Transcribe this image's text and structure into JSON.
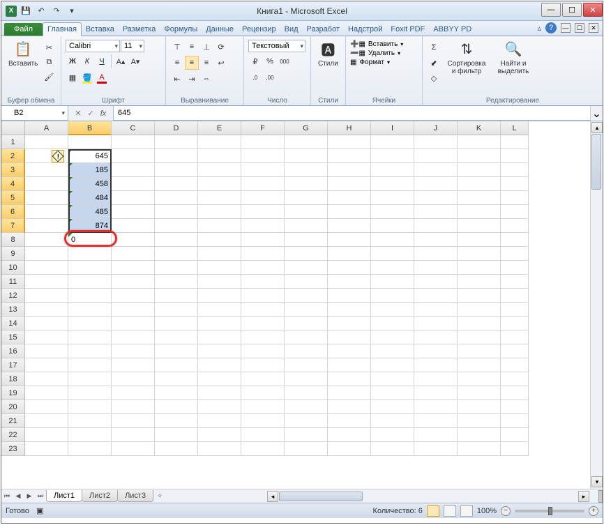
{
  "window": {
    "title": "Книга1 - Microsoft Excel"
  },
  "tabs": {
    "file": "Файл",
    "list": [
      "Главная",
      "Вставка",
      "Разметка",
      "Формулы",
      "Данные",
      "Рецензир",
      "Вид",
      "Разработ",
      "Надстрой",
      "Foxit PDF",
      "ABBYY PD"
    ],
    "active_index": 0
  },
  "ribbon": {
    "clipboard": {
      "label": "Буфер обмена",
      "paste": "Вставить"
    },
    "font": {
      "label": "Шрифт",
      "name": "Calibri",
      "size": "11",
      "bold": "Ж",
      "italic": "К",
      "underline": "Ч"
    },
    "alignment": {
      "label": "Выравнивание"
    },
    "number": {
      "label": "Число",
      "format": "Текстовый",
      "percent": "%",
      "comma": "000",
      "inc": ",0",
      "dec": ",00"
    },
    "styles": {
      "label": "Стили",
      "btn": "Стили"
    },
    "cells": {
      "label": "Ячейки",
      "insert": "Вставить",
      "delete": "Удалить",
      "format": "Формат"
    },
    "editing": {
      "label": "Редактирование",
      "sort": "Сортировка и фильтр",
      "find": "Найти и выделить"
    }
  },
  "formula_bar": {
    "name_box": "B2",
    "fx": "fx",
    "value": "645"
  },
  "grid": {
    "columns": [
      "A",
      "B",
      "C",
      "D",
      "E",
      "F",
      "G",
      "H",
      "I",
      "J",
      "K",
      "L"
    ],
    "row_count": 23,
    "selected_col": "B",
    "selected_rows_start": 2,
    "selected_rows_end": 7,
    "active_cell": "B2",
    "cells": {
      "B2": "645",
      "B3": "185",
      "B4": "458",
      "B5": "484",
      "B6": "485",
      "B7": "874",
      "B8": "0"
    },
    "error_badge_at": "B2",
    "red_ring_at": "B8"
  },
  "sheets": {
    "list": [
      "Лист1",
      "Лист2",
      "Лист3"
    ],
    "active_index": 0
  },
  "statusbar": {
    "ready": "Готово",
    "count_label": "Количество: 6",
    "zoom": "100%"
  }
}
